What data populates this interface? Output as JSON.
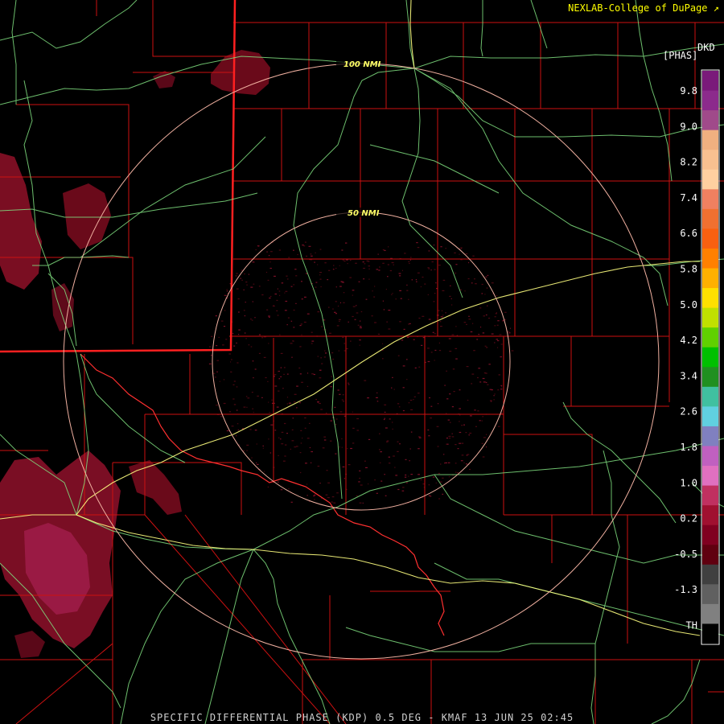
{
  "header": {
    "credit": "NEXLAB-College of DuPage"
  },
  "legend": {
    "product_code": "DKD",
    "units": "[PHAS]",
    "ticks": [
      "9.8",
      "9.0",
      "8.2",
      "7.4",
      "6.6",
      "5.8",
      "5.0",
      "4.2",
      "3.4",
      "2.6",
      "1.8",
      "1.0",
      "0.2",
      "-0.5",
      "-1.3",
      "TH"
    ],
    "colors": [
      "#7a1a7a",
      "#8c2a8c",
      "#a04a8a",
      "#f0b080",
      "#f8c090",
      "#ffd0a0",
      "#f08060",
      "#f07030",
      "#f86010",
      "#ff8000",
      "#ffb000",
      "#ffe000",
      "#c0e000",
      "#60d000",
      "#00c000",
      "#209020",
      "#40c0a0",
      "#60d0e0",
      "#8080c0",
      "#c060c0",
      "#e070c0",
      "#c03060",
      "#a01030",
      "#800020",
      "#600010",
      "#404040",
      "#606060",
      "#808080",
      "#000000"
    ]
  },
  "rings": [
    {
      "label": "50 NMI"
    },
    {
      "label": "100 NMI"
    }
  ],
  "footer": {
    "caption": "SPECIFIC DIFFERENTIAL PHASE (KDP) 0.5 DEG - KMAF 13 JUN 25 02:45"
  },
  "colors": {
    "county_lines": "#cc1111",
    "state_line": "#ff2020",
    "highways": "#80e080",
    "interstates": "#ffff80",
    "rivers": "#ff3030",
    "range_rings": "#f0b0a0",
    "echo_dark": "#6a0a1a",
    "echo_mid": "#8a1030",
    "echo_bright": "#a82050"
  }
}
